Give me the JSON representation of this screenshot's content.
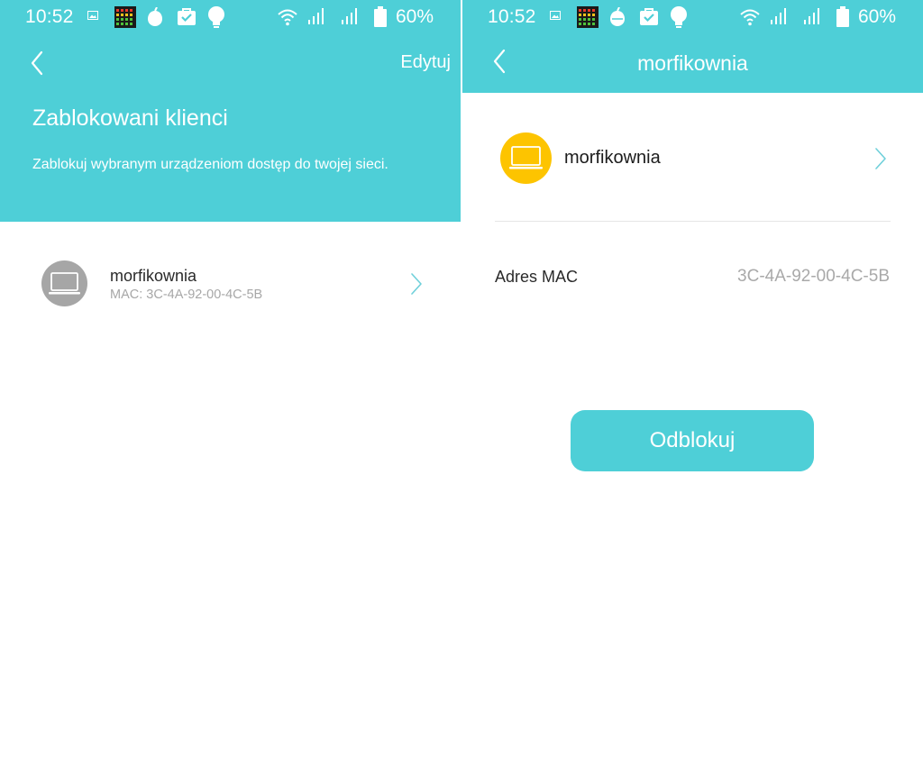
{
  "status_bar": {
    "time": "10:52",
    "battery_percent": "60%"
  },
  "colors": {
    "accent": "#4ecfd7",
    "device_yellow": "#fdc400",
    "device_grey": "#a6a6a6",
    "chevron": "#6fd0da"
  },
  "left_screen": {
    "edit_label": "Edytuj",
    "title": "Zablokowani klienci",
    "subtitle": "Zablokuj wybranym urządzeniom dostęp do twojej sieci.",
    "clients": [
      {
        "name": "morfikownia",
        "mac": "MAC: 3C-4A-92-00-4C-5B",
        "icon": "laptop-icon"
      }
    ]
  },
  "right_screen": {
    "title": "morfikownia",
    "device_name": "morfikownia",
    "device_icon": "laptop-icon",
    "mac_label": "Adres MAC",
    "mac_value": "3C-4A-92-00-4C-5B",
    "unblock_label": "Odblokuj"
  }
}
